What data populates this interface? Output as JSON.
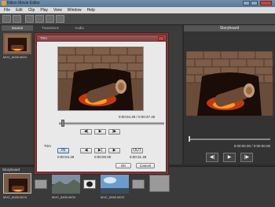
{
  "window": {
    "title": "Nikon Movie Editor"
  },
  "menu": [
    "File",
    "Edit",
    "Clip",
    "Play",
    "View",
    "Window",
    "Help"
  ],
  "tabs": {
    "source": "Source",
    "transition": "Transitions",
    "audio": "Audio"
  },
  "source_clip": {
    "name": "MVC_6000.MOV"
  },
  "right_panel": {
    "title": "Storyboard",
    "time": "0:00:00.00 / 0:00:00.00"
  },
  "storyboard": {
    "title": "Storyboard",
    "clips": [
      {
        "name": "MVC_6000.MOV"
      },
      {
        "name": "MVC_6400.MOV"
      },
      {
        "name": "MVC_6592.MOV"
      }
    ]
  },
  "dialog": {
    "title": "Trim",
    "time": "0:00:04.49 / 0:00:37.40",
    "trim_label": "Trim",
    "in_label": "IN",
    "out_label": "OUT",
    "in_time": "0:00:04.49",
    "mid_time": "0:00:00.00",
    "out_time": "0:00:31.49",
    "ok_label": "OK",
    "cancel_label": "Cancel"
  },
  "icons": {
    "prev_frame": "step-back-icon",
    "play": "play-icon",
    "next_frame": "step-forward-icon"
  }
}
